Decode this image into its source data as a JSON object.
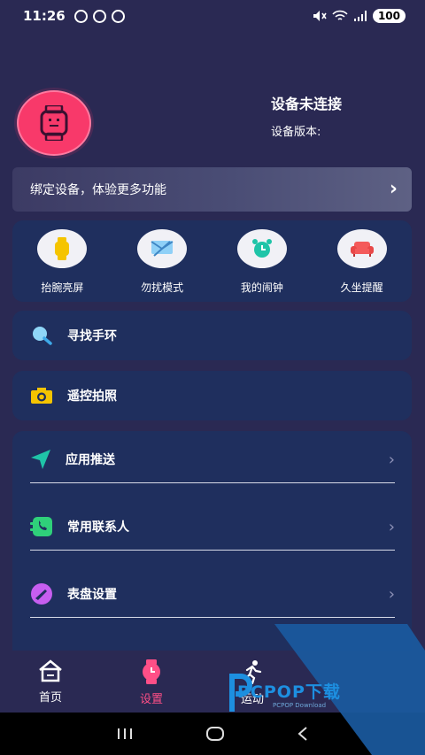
{
  "status_bar": {
    "time": "11:26",
    "battery": "100"
  },
  "device": {
    "status": "设备未连接",
    "version_label": "设备版本:"
  },
  "bind_banner": {
    "text": "绑定设备，体验更多功能"
  },
  "quick_actions": [
    {
      "label": "抬腕亮屏",
      "icon": "watch-raise-icon"
    },
    {
      "label": "勿扰模式",
      "icon": "message-mute-icon"
    },
    {
      "label": "我的闹钟",
      "icon": "alarm-clock-icon"
    },
    {
      "label": "久坐提醒",
      "icon": "sofa-icon"
    }
  ],
  "cards": {
    "find_band": {
      "label": "寻找手环",
      "icon": "search-icon"
    },
    "remote_photo": {
      "label": "遥控拍照",
      "icon": "camera-icon"
    }
  },
  "settings_list": [
    {
      "label": "应用推送",
      "icon": "send-icon"
    },
    {
      "label": "常用联系人",
      "icon": "contacts-icon"
    },
    {
      "label": "表盘设置",
      "icon": "watch-face-icon"
    }
  ],
  "tabs": [
    {
      "label": "首页",
      "icon": "home-icon"
    },
    {
      "label": "设置",
      "icon": "settings-watch-icon",
      "active": true
    },
    {
      "label": "运动",
      "icon": "running-icon"
    }
  ],
  "watermark": {
    "text": "PCPOP下载",
    "sub": "PCPOP Download"
  },
  "colors": {
    "background": "#2a2953",
    "card": "#1f2f5e",
    "accent": "#ff4f87"
  }
}
